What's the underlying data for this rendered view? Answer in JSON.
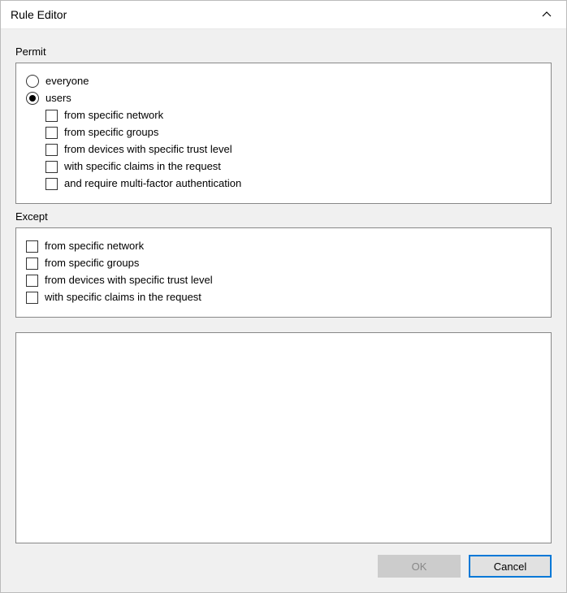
{
  "title": "Rule Editor",
  "sections": {
    "permit": {
      "label": "Permit",
      "radios": {
        "everyone": {
          "label": "everyone",
          "checked": false
        },
        "users": {
          "label": "users",
          "checked": true
        }
      },
      "userChecks": [
        {
          "label": "from specific network",
          "checked": false
        },
        {
          "label": "from specific groups",
          "checked": false
        },
        {
          "label": "from devices with specific trust level",
          "checked": false
        },
        {
          "label": "with specific claims in the request",
          "checked": false
        },
        {
          "label": "and require multi-factor authentication",
          "checked": false
        }
      ]
    },
    "except": {
      "label": "Except",
      "checks": [
        {
          "label": "from specific network",
          "checked": false
        },
        {
          "label": "from specific groups",
          "checked": false
        },
        {
          "label": "from devices with specific trust level",
          "checked": false
        },
        {
          "label": "with specific claims in the request",
          "checked": false
        }
      ]
    }
  },
  "buttons": {
    "ok": "OK",
    "cancel": "Cancel"
  }
}
